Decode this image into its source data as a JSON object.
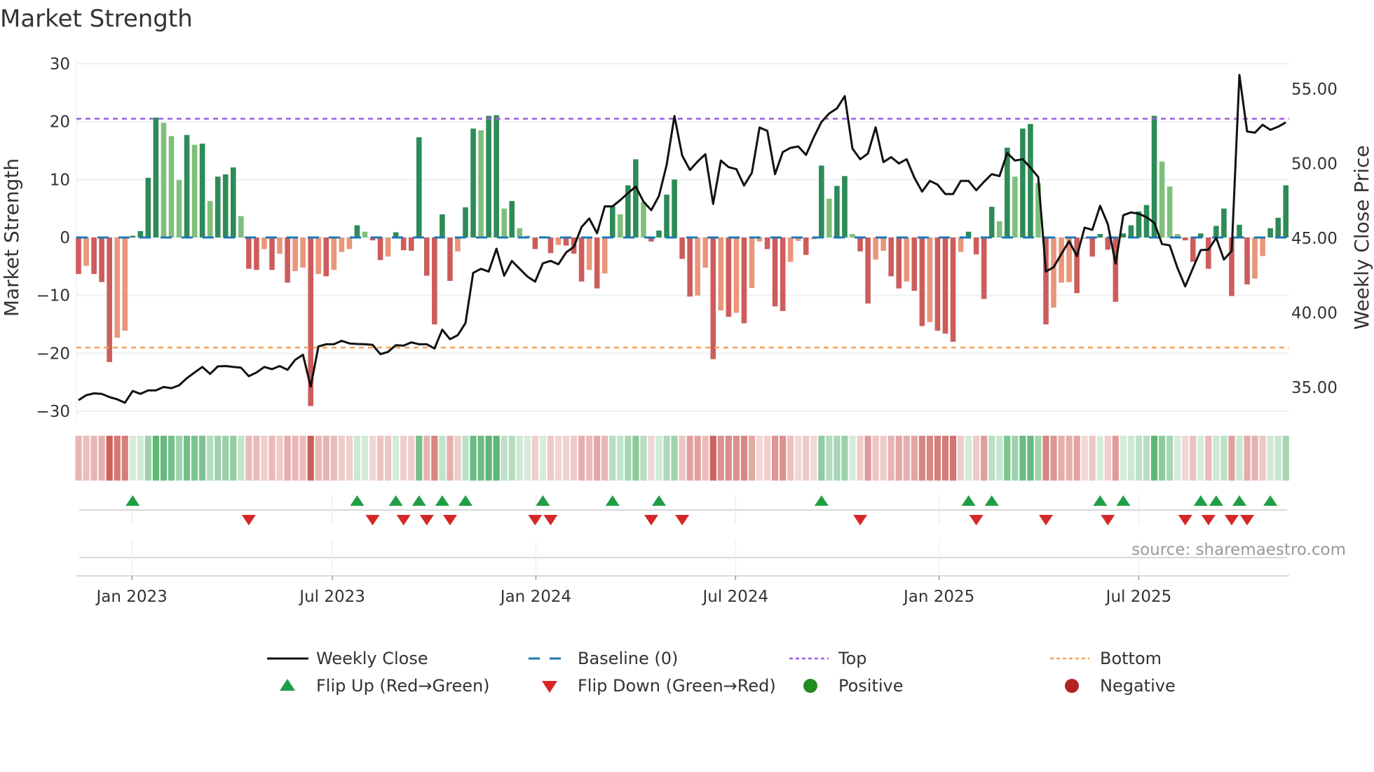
{
  "chart_data": {
    "type": "bar",
    "title": "Market Strength",
    "ylabel": "Market Strength",
    "y2label": "Weekly Close Price",
    "ylim": [
      -30,
      30
    ],
    "y2lim": [
      33.2,
      57.4
    ],
    "yticks": [
      "30",
      "20",
      "10",
      "0",
      "−10",
      "−20",
      "−30"
    ],
    "ytick_values": [
      30,
      20,
      10,
      0,
      -10,
      -20,
      -30
    ],
    "y2ticks": [
      "55.00",
      "50.00",
      "45.00",
      "40.00",
      "35.00"
    ],
    "y2tick_values": [
      55,
      50,
      45,
      40,
      35
    ],
    "xticks": [
      {
        "label": "Jan 2023",
        "week": 6.9
      },
      {
        "label": "Jul 2023",
        "week": 32.8
      },
      {
        "label": "Jan 2024",
        "week": 59.1
      },
      {
        "label": "Jul 2024",
        "week": 84.9
      },
      {
        "label": "Jan 2025",
        "week": 111.2
      },
      {
        "label": "Jul 2025",
        "week": 137.0
      }
    ],
    "top_level": 20.5,
    "bottom_level": -19,
    "baseline": 0,
    "strength": [
      -6.3,
      -4.9,
      -6.3,
      -7.7,
      -21.5,
      -17.3,
      -16.1,
      0.3,
      1.1,
      10.3,
      20.7,
      19.8,
      17.5,
      9.9,
      17.7,
      16,
      16.2,
      6.3,
      10.5,
      10.9,
      12.1,
      3.7,
      -5.4,
      -5.6,
      -2,
      -5.6,
      -2.8,
      -7.8,
      -5.8,
      -5.2,
      -29.1,
      -6.3,
      -6.7,
      -5.6,
      -2.5,
      -2,
      2.1,
      1,
      -0.5,
      -3.9,
      -3.3,
      0.9,
      -2.2,
      -2.3,
      17.3,
      -6.6,
      -15,
      4,
      -7.5,
      -2.4,
      5.2,
      18.8,
      18.5,
      21,
      21.1,
      5,
      6.3,
      1.6,
      0.3,
      -2,
      0.2,
      -2.7,
      -1.3,
      -1.4,
      -2.8,
      -7.6,
      -5.6,
      -8.8,
      -6.2,
      5.4,
      4,
      9,
      13.5,
      6.1,
      -0.7,
      1.2,
      7.4,
      10,
      -3.7,
      -10.2,
      -10,
      -5.2,
      -21,
      -12.6,
      -13.7,
      -13,
      -14.8,
      -8.7,
      -0.7,
      -2,
      -11.9,
      -12.7,
      -4.2,
      -0.6,
      -3,
      -0.3,
      12.4,
      6.7,
      8.9,
      10.6,
      0.6,
      -2.4,
      -11.4,
      -3.8,
      -2.3,
      -6.7,
      -8.8,
      -7.6,
      -9.2,
      -15.3,
      -14.6,
      -16.1,
      -16.6,
      -18,
      -2.5,
      1,
      -2.9,
      -10.6,
      5.3,
      2.8,
      15.5,
      10.5,
      18.8,
      19.6,
      9.4,
      -15,
      -12.1,
      -7.8,
      -7.7,
      -9.6,
      -0.2,
      -3.3,
      0.6,
      -2.1,
      -11.1,
      0.7,
      2.1,
      4.5,
      5.6,
      21,
      13.1,
      8.8,
      0.6,
      -0.5,
      -4.2,
      0.7,
      -5.4,
      2,
      5,
      -10.1,
      2.2,
      -8.1,
      -7.1,
      -3.2,
      1.6,
      3.4,
      9
    ],
    "weekly_close": [
      34.14,
      34.48,
      34.6,
      34.57,
      34.35,
      34.2,
      33.97,
      34.76,
      34.57,
      34.8,
      34.8,
      35.03,
      34.95,
      35.14,
      35.62,
      36,
      36.37,
      35.9,
      36.41,
      36.43,
      36.37,
      36.32,
      35.75,
      36,
      36.37,
      36.22,
      36.43,
      36.18,
      36.85,
      37.19,
      35.05,
      37.74,
      37.89,
      37.89,
      38.12,
      37.95,
      37.91,
      37.89,
      37.85,
      37.23,
      37.38,
      37.83,
      37.8,
      38.02,
      37.89,
      37.89,
      37.61,
      38.87,
      38.23,
      38.5,
      39.31,
      42.68,
      42.95,
      42.76,
      44.29,
      42.49,
      43.48,
      42.95,
      42.43,
      42.09,
      43.32,
      43.48,
      43.25,
      44.04,
      44.42,
      45.75,
      46.32,
      45.33,
      47.13,
      47.13,
      47.55,
      48.02,
      48.46,
      47.45,
      46.88,
      47.83,
      49.92,
      53.19,
      50.54,
      49.57,
      50.14,
      50.63,
      47.3,
      50.2,
      49.76,
      49.63,
      48.53,
      49.38,
      52.42,
      52.19,
      49.29,
      50.77,
      51.05,
      51.15,
      50.58,
      51.75,
      52.79,
      53.36,
      53.7,
      54.52,
      51.01,
      50.29,
      50.67,
      52.43,
      50.1,
      50.43,
      50.01,
      50.29,
      49.06,
      48.12,
      48.84,
      48.59,
      47.96,
      47.96,
      48.84,
      48.84,
      48.21,
      48.78,
      49.29,
      49.16,
      50.71,
      50.2,
      50.29,
      49.73,
      49.1,
      42.76,
      43.06,
      43.95,
      44.8,
      43.8,
      45.71,
      45.56,
      47.17,
      45.94,
      43.29,
      46.54,
      46.73,
      46.64,
      46.41,
      46.03,
      44.61,
      44.52,
      43,
      41.77,
      43,
      44.2,
      44.23,
      45.03,
      43.57,
      44.14,
      55.94,
      52.15,
      52.07,
      52.6,
      52.26,
      52.47,
      52.76
    ],
    "legend": {
      "weekly_close": "Weekly Close",
      "baseline": "Baseline (0)",
      "top": "Top",
      "bottom": "Bottom",
      "flip_up": "Flip Up (Red→Green)",
      "flip_down": "Flip Down (Green→Red)",
      "positive": "Positive",
      "negative": "Negative"
    },
    "legend_placement": "bottom",
    "source": "source: sharemaestro.com"
  },
  "colors": {
    "pos_strong": "#2e8b57",
    "pos_weak": "#7fbf7b",
    "neg_strong": "#cd5c5c",
    "neg_weak": "#e9967a",
    "baseline": "#1f77b4",
    "top": "#9b5fe0",
    "bottom": "#f4a259",
    "line": "#111111",
    "flip_up": "#1e9e46",
    "flip_down": "#d62728",
    "positive": "#228b22",
    "negative": "#b22222"
  }
}
